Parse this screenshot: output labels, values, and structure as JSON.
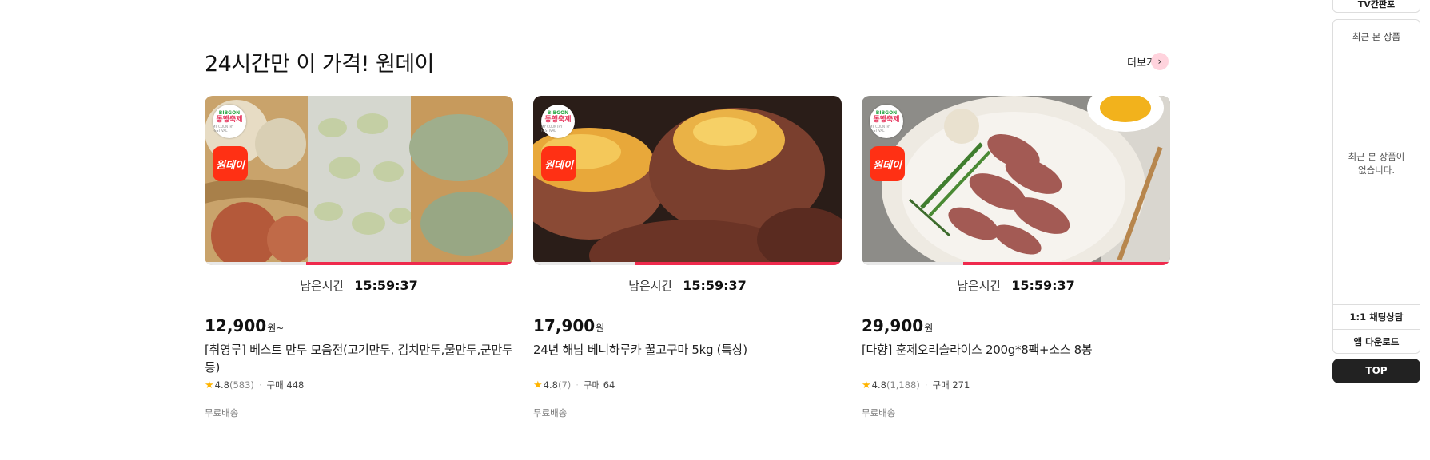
{
  "section": {
    "title": "24시간만 이 가격! 원데이",
    "more_label": "더보기",
    "more_icon": "chevron-right-icon"
  },
  "products": [
    {
      "brand_badge": {
        "line1": "BIBGON",
        "line2": "동행축제",
        "line3": "MY COUNTRY FESTIVAL"
      },
      "oneday_badge": "원데이",
      "timer_label": "남은시간",
      "timer_value": "15:59:37",
      "remaining_fraction": 0.67,
      "price": "12,900",
      "price_unit": "원~",
      "name": "[취영루] 베스트 만두 모음전(고기만두, 김치만두,물만두,군만두 등)",
      "rating": "4.8",
      "review_count": "(583)",
      "purchase": "구매 448",
      "shipping": "무료배송"
    },
    {
      "brand_badge": {
        "line1": "BIBGON",
        "line2": "동행축제",
        "line3": "MY COUNTRY FESTIVAL"
      },
      "oneday_badge": "원데이",
      "timer_label": "남은시간",
      "timer_value": "15:59:37",
      "remaining_fraction": 0.67,
      "price": "17,900",
      "price_unit": "원",
      "name": "24년 해남 베니하루카 꿀고구마 5kg (특상)",
      "rating": "4.8",
      "review_count": "(7)",
      "purchase": "구매 64",
      "shipping": "무료배송"
    },
    {
      "brand_badge": {
        "line1": "BIBGON",
        "line2": "동행축제",
        "line3": "MY COUNTRY FESTIVAL"
      },
      "oneday_badge": "원데이",
      "timer_label": "남은시간",
      "timer_value": "15:59:37",
      "remaining_fraction": 0.67,
      "price": "29,900",
      "price_unit": "원",
      "name": "[다향] 훈제오리슬라이스 200g*8팩+소스 8봉",
      "rating": "4.8",
      "review_count": "(1,188)",
      "purchase": "구매 271",
      "shipping": "무료배송"
    }
  ],
  "sidebar": {
    "top_box_label": "TV간판포",
    "recent_title": "최근 본 상품",
    "recent_empty": "최근 본 상품이 없습니다.",
    "chat_label": "1:1 채팅상담",
    "app_label": "앱 다운로드",
    "top_label": "TOP"
  },
  "colors": {
    "accent": "#ef2a4d",
    "oneday_badge": "#ff3014",
    "star": "#ffb400",
    "top_button": "#222222"
  }
}
